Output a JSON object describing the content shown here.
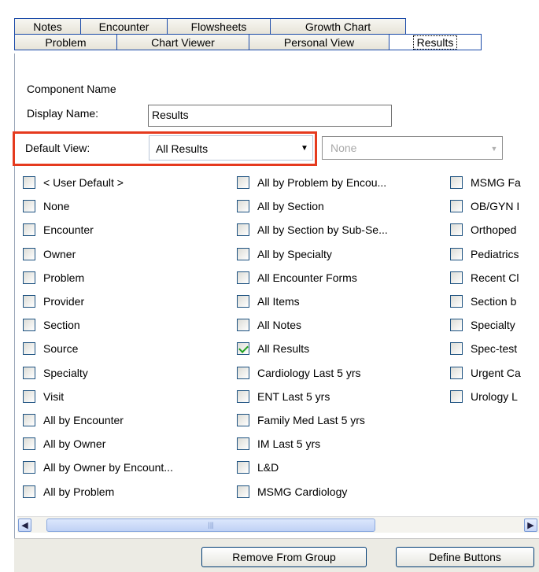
{
  "tabs_row1": [
    "Notes",
    "Encounter",
    "Flowsheets",
    "Growth Chart"
  ],
  "tabs_row2": [
    "Problem",
    "Chart Viewer",
    "Personal View",
    "Results"
  ],
  "form": {
    "component_name_label": "Component Name",
    "display_name_label": "Display Name:",
    "display_name_value": "Results",
    "default_view_label": "Default View:",
    "default_view_value": "All Results",
    "secondary_select_value": "None"
  },
  "columns": [
    [
      "< User Default >",
      "None",
      "Encounter",
      "Owner",
      "Problem",
      "Provider",
      "Section",
      "Source",
      "Specialty",
      "Visit",
      "All by Encounter",
      "All by Owner",
      "All by Owner by Encount...",
      "All by Problem"
    ],
    [
      "All by Problem by Encou...",
      "All by Section",
      "All by Section by Sub-Se...",
      "All by Specialty",
      "All Encounter Forms",
      "All Items",
      "All Notes",
      "All Results",
      "Cardiology Last 5 yrs",
      "ENT Last 5 yrs",
      "Family Med Last 5 yrs",
      "IM Last 5 yrs",
      "L&D",
      "MSMG Cardiology"
    ],
    [
      "MSMG Fa",
      "OB/GYN I",
      "Orthoped",
      "Pediatrics",
      "Recent Cl",
      "Section b",
      "Specialty",
      "Spec-test",
      "Urgent Ca",
      "Urology L"
    ]
  ],
  "checked": [
    "All Results"
  ],
  "buttons": {
    "remove": "Remove From Group",
    "define": "Define Buttons"
  }
}
